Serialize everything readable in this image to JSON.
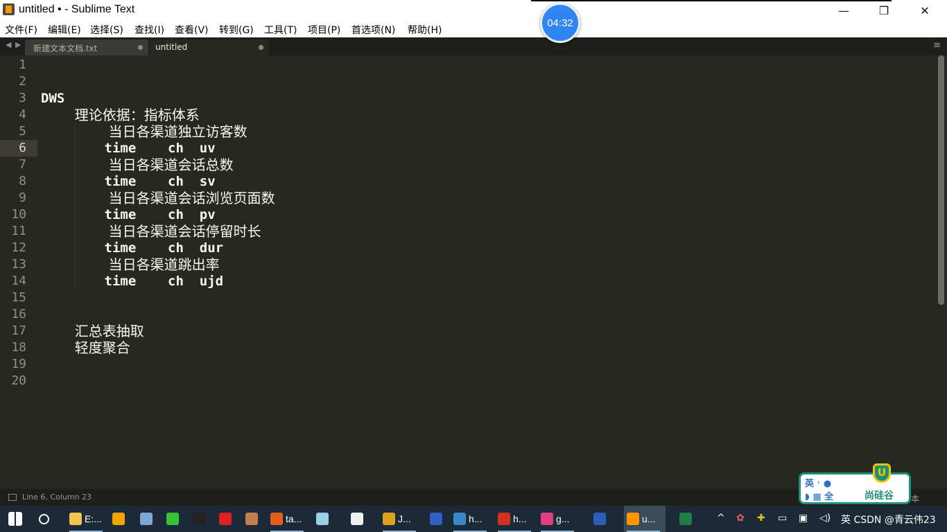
{
  "window": {
    "title": "untitled • - Sublime Text",
    "minimize": "—",
    "maximize": "❐",
    "close": "✕"
  },
  "timer": "04:32",
  "menu": [
    "文件(F)",
    "编辑(E)",
    "选择(S)",
    "查找(I)",
    "查看(V)",
    "转到(G)",
    "工具(T)",
    "项目(P)",
    "首选项(N)",
    "帮助(H)"
  ],
  "tabs": {
    "nav_left": "◀",
    "nav_right": "▶",
    "items": [
      {
        "label": "新建文本文档.txt",
        "active": false
      },
      {
        "label": "untitled",
        "active": true
      }
    ],
    "menu_glyph": "≡"
  },
  "editor": {
    "current_line": 6,
    "line_numbers": [
      "1",
      "2",
      "3",
      "4",
      "5",
      "6",
      "7",
      "8",
      "9",
      "10",
      "11",
      "12",
      "13",
      "14",
      "15",
      "16",
      "17",
      "18",
      "19",
      "20"
    ],
    "lines": [
      "",
      "",
      "DWS",
      "    理论依据：指标体系",
      "        当日各渠道独立访客数",
      "        time    ch  uv",
      "        当日各渠道会话总数",
      "        time    ch  sv",
      "        当日各渠道会话浏览页面数",
      "        time    ch  pv",
      "        当日各渠道会话停留时长",
      "        time    ch  dur",
      "        当日各渠道跳出率",
      "        time    ch  ujd",
      "",
      "",
      "    汇总表抽取",
      "    轻度聚合",
      "",
      ""
    ]
  },
  "status": {
    "position": "Line 6, Column 23",
    "right_text": "本"
  },
  "logo": {
    "ying": "英 ˒ ●",
    "quan": "◗ ▦ 全",
    "u": "U",
    "name": "尚硅谷"
  },
  "taskbar": {
    "items": [
      {
        "label": "",
        "icon": "windows-icon",
        "color": "#ffffff"
      },
      {
        "label": "",
        "icon": "search-icon",
        "color": "#ffffff"
      },
      {
        "label": "E:...",
        "icon": "folder-icon",
        "color": "#f2c14e"
      },
      {
        "label": "",
        "icon": "k-app-icon",
        "color": "#f2a500"
      },
      {
        "label": "",
        "icon": "screenshot-icon",
        "color": "#7fa8d8"
      },
      {
        "label": "",
        "icon": "wechat-icon",
        "color": "#37c337"
      },
      {
        "label": "",
        "icon": "qq-icon",
        "color": "#222222"
      },
      {
        "label": "",
        "icon": "youdao-icon",
        "color": "#e02020"
      },
      {
        "label": "",
        "icon": "avatar-icon",
        "color": "#c08050"
      },
      {
        "label": "ta...",
        "icon": "browser-icon",
        "color": "#e06020"
      },
      {
        "label": "",
        "icon": "flower-icon",
        "color": "#9ad0e6"
      },
      {
        "label": "",
        "icon": "smile-icon",
        "color": "#f0f0f0"
      },
      {
        "label": "J...",
        "icon": "chrome-icon",
        "color": "#e0a020"
      },
      {
        "label": "",
        "icon": "p-app-icon",
        "color": "#3060c0"
      },
      {
        "label": "h...",
        "icon": "vm-icon",
        "color": "#3a88c8"
      },
      {
        "label": "h...",
        "icon": "redis-icon",
        "color": "#d03020"
      },
      {
        "label": "g...",
        "icon": "idea-icon",
        "color": "#e04080"
      },
      {
        "label": "",
        "icon": "word-icon",
        "color": "#2b5fb3"
      },
      {
        "label": "u...",
        "icon": "sublime-icon",
        "color": "#ff9800"
      },
      {
        "label": "",
        "icon": "excel-icon",
        "color": "#1e7e45"
      }
    ],
    "tray_text": "英 CSDN @青云伟23"
  }
}
